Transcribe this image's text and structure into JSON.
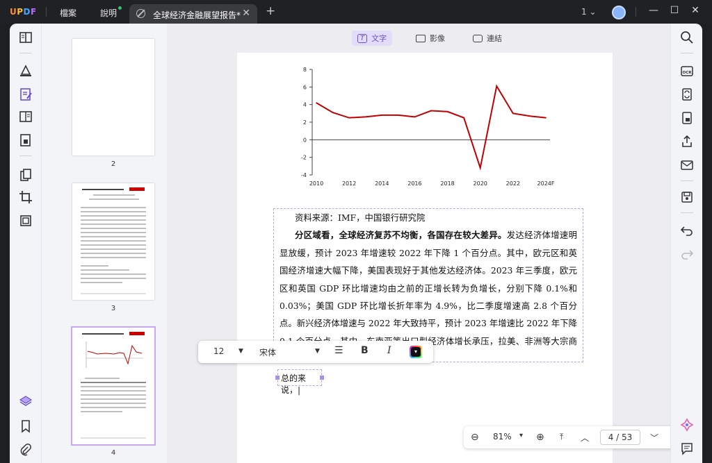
{
  "app": {
    "logo": "UPDF"
  },
  "menu": {
    "file": "檔案",
    "help": "說明"
  },
  "tab": {
    "title": "全球经济金融展望报告*"
  },
  "window": {
    "page_count": "1"
  },
  "modes": {
    "text": "文字",
    "image": "影像",
    "link": "連結"
  },
  "thumbnails": [
    {
      "label": "2"
    },
    {
      "label": "3"
    },
    {
      "label": "4"
    }
  ],
  "chart_data": {
    "type": "line",
    "categories": [
      "2010",
      "2011",
      "2012",
      "2013",
      "2014",
      "2015",
      "2016",
      "2017",
      "2018",
      "2019",
      "2020",
      "2021",
      "2022",
      "2023",
      "2024F"
    ],
    "values": [
      4.2,
      3.1,
      2.5,
      2.6,
      2.8,
      2.8,
      2.6,
      3.3,
      3.2,
      2.5,
      -3.2,
      6.1,
      3.0,
      2.7,
      2.5
    ],
    "x_tick_labels": [
      "2010",
      "2012",
      "2014",
      "2016",
      "2018",
      "2020",
      "2022",
      "2024F"
    ],
    "y_tick_labels": [
      "8",
      "6",
      "4",
      "2",
      "0",
      "-2",
      "-4"
    ],
    "ylim": [
      -4,
      8
    ],
    "color": "#c00000"
  },
  "doc": {
    "source": "资料来源：IMF，中国银行研究院",
    "para_bold": "分区域看，全球经济复苏不均衡，各国存在较大差异。",
    "para_rest": "发达经济体增速明显放缓，预计 2023 年增速较 2022 年下降 1 个百分点。其中，欧元区和英国经济增速大幅下降，美国表现好于其他发达经济体。2023 年三季度，欧元区和英国 GDP 环比增速均由之前的正增长转为负增长，分别下降 0.1%和 0.03%；美国 GDP 环比增长折年率为 4.9%，比二季度增速高 2.8 个百分点。新兴经济体增速与 2022 年大致持平，预计 2023 年增速比 2022 年下降 0.1 个百分点。其中，东南亚等出口型经济体增长承压，拉美、非洲等大宗商品出口国增速放缓，中",
    "summary": "总的来说，"
  },
  "format": {
    "font_size": "12",
    "font_name": "宋体",
    "bold": "B",
    "italic": "I"
  },
  "zoom": {
    "level": "81%",
    "current_page": "4",
    "total_pages": "53"
  }
}
